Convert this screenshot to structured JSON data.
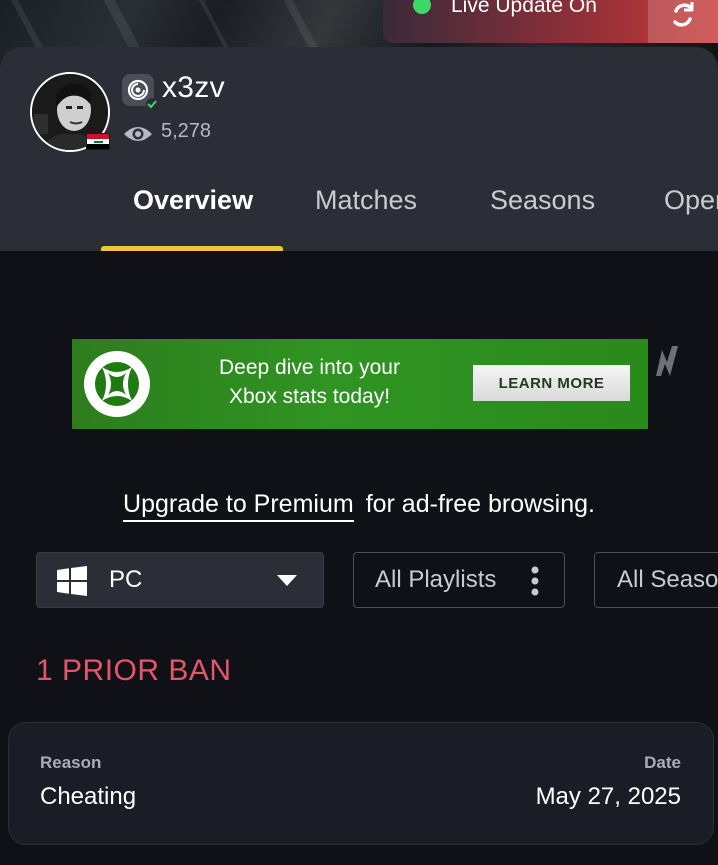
{
  "live_update": {
    "label": "Live Update On",
    "status_color": "#3bd86a"
  },
  "profile": {
    "username": "x3zv",
    "views": "5,278",
    "platform_icon": "ubisoft-icon",
    "country_flag": "iraq-flag"
  },
  "tabs": [
    {
      "label": "Overview",
      "active": true
    },
    {
      "label": "Matches",
      "active": false
    },
    {
      "label": "Seasons",
      "active": false
    },
    {
      "label": "Oper",
      "active": false
    }
  ],
  "ad": {
    "text_line1": "Deep dive into your",
    "text_line2": "Xbox stats today!",
    "button_label": "LEARN MORE"
  },
  "upgrade": {
    "link_label": "Upgrade to Premium",
    "suffix": "for ad-free browsing."
  },
  "filters": {
    "platform": "PC",
    "playlist": "All Playlists",
    "season": "All Seaso"
  },
  "bans": {
    "heading": "1 PRIOR BAN",
    "reason_label": "Reason",
    "reason_value": "Cheating",
    "date_label": "Date",
    "date_value": "May 27, 2025"
  },
  "colors": {
    "accent_tab": "#f0c33c",
    "ban_heading": "#e5566a",
    "ad_green": "#2f9422"
  }
}
